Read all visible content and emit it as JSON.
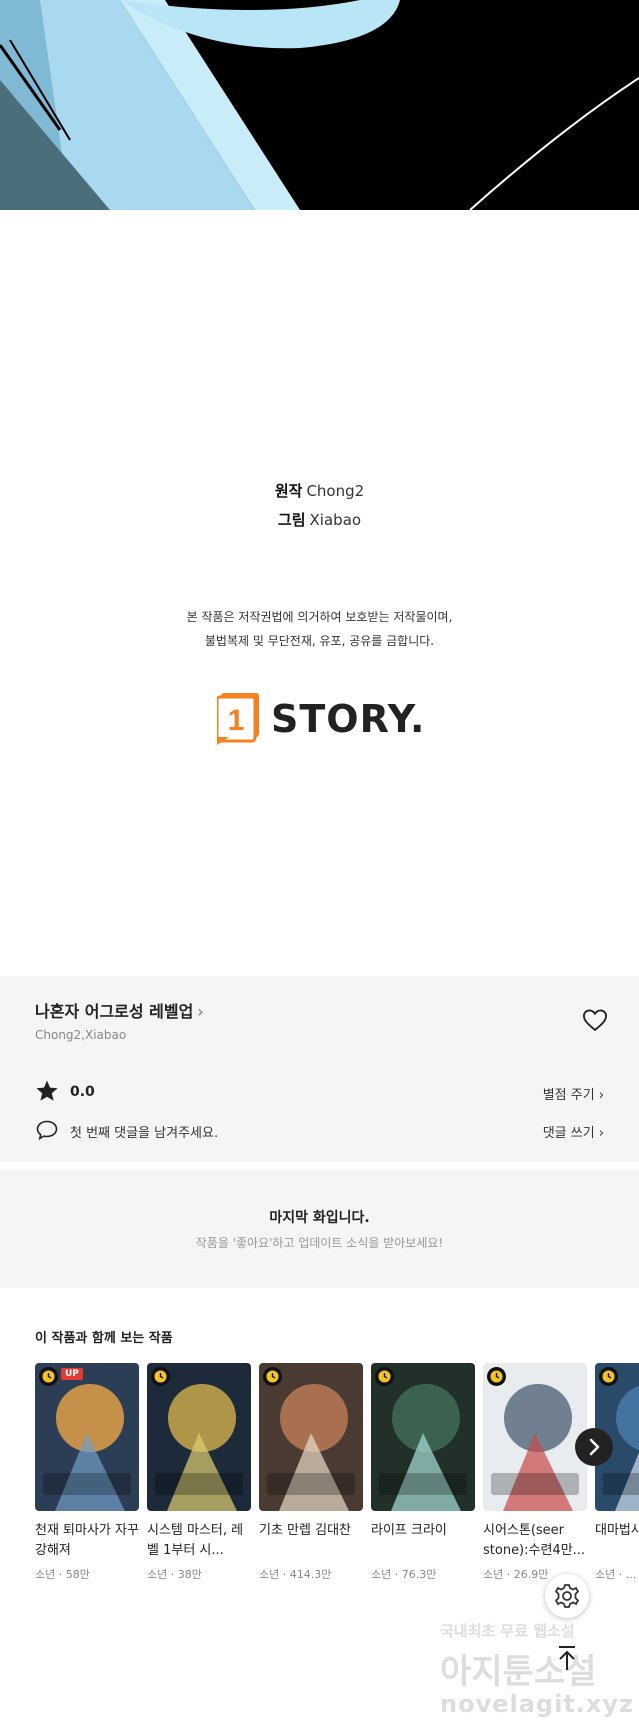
{
  "credits": {
    "original_label": "원작",
    "original_value": "Chong2",
    "art_label": "그림",
    "art_value": "Xiabao"
  },
  "notice": {
    "line1": "본 작품은 저작권법에 의거하여 보호받는 저작물이며,",
    "line2": "불법복제 및 무단전재, 유포, 공유를 금합니다."
  },
  "logo": {
    "text": "STORY.",
    "badge": "1",
    "color": "#f5821f"
  },
  "info": {
    "title": "나혼자 어그로성 레벨업",
    "title_chevron": "›",
    "authors": "Chong2,Xiabao",
    "rating": "0.0",
    "rate_button": "별점 주기 ›",
    "comment_prompt": "첫 번째 댓글을 남겨주세요.",
    "comment_button": "댓글 쓰기 ›"
  },
  "last_episode": {
    "title": "마지막 화입니다.",
    "subtitle": "작품을 '좋아요'하고 업데이트 소식을 받아보세요!"
  },
  "recommendations": {
    "heading": "이 작품과 함께 보는 작품",
    "items": [
      {
        "title": "천재 퇴마사가 자꾸 강해져",
        "meta": "소년 · 58만",
        "badge": "UP",
        "icon": "clock-icon"
      },
      {
        "title": "시스템 마스터, 레벨 1부터 시...",
        "meta": "소년 · 38만",
        "badge": "",
        "icon": "clock-icon"
      },
      {
        "title": "기초 만렙 김대찬",
        "meta": "소년 · 414.3만",
        "badge": "",
        "icon": "clock-icon"
      },
      {
        "title": "라이프 크라이",
        "meta": "소년 · 76.3만",
        "badge": "",
        "icon": "clock-icon"
      },
      {
        "title": "시어스톤(seer stone):수련4만...",
        "meta": "소년 · 26.9만",
        "badge": "",
        "icon": "clock-icon"
      },
      {
        "title": "대마법사...",
        "meta": "소년 · ...",
        "badge": "",
        "icon": "clock-icon"
      }
    ]
  },
  "watermark": {
    "line1": "국내최초 무료 웹소설",
    "line2": "아지툰소설",
    "line3": "novelagit.xyz"
  },
  "colors": {
    "panel": "#f5f5f5",
    "accent": "#f5821f",
    "up_badge": "#e53935"
  },
  "icons": [
    "heart-icon",
    "star-icon",
    "speech-bubble-icon",
    "chevron-right-icon",
    "gear-icon",
    "arrow-up-icon",
    "clock-icon"
  ]
}
